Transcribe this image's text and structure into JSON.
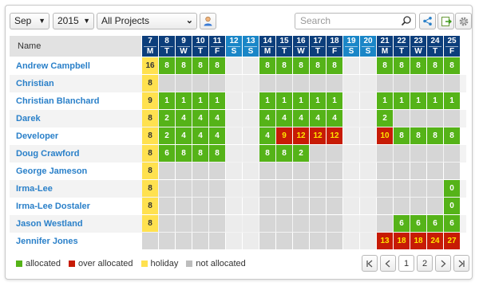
{
  "toolbar": {
    "month": "Sep",
    "year": "2015",
    "project": "All Projects",
    "search_placeholder": "Search"
  },
  "header": {
    "name_label": "Name",
    "days": [
      {
        "num": "7",
        "dow": "M",
        "weekend": false
      },
      {
        "num": "8",
        "dow": "T",
        "weekend": false
      },
      {
        "num": "9",
        "dow": "W",
        "weekend": false
      },
      {
        "num": "10",
        "dow": "T",
        "weekend": false
      },
      {
        "num": "11",
        "dow": "F",
        "weekend": false
      },
      {
        "num": "12",
        "dow": "S",
        "weekend": true
      },
      {
        "num": "13",
        "dow": "S",
        "weekend": true
      },
      {
        "num": "14",
        "dow": "M",
        "weekend": false
      },
      {
        "num": "15",
        "dow": "T",
        "weekend": false
      },
      {
        "num": "16",
        "dow": "W",
        "weekend": false
      },
      {
        "num": "17",
        "dow": "T",
        "weekend": false
      },
      {
        "num": "18",
        "dow": "F",
        "weekend": false
      },
      {
        "num": "19",
        "dow": "S",
        "weekend": true
      },
      {
        "num": "20",
        "dow": "S",
        "weekend": true
      },
      {
        "num": "21",
        "dow": "M",
        "weekend": false
      },
      {
        "num": "22",
        "dow": "T",
        "weekend": false
      },
      {
        "num": "23",
        "dow": "W",
        "weekend": false
      },
      {
        "num": "24",
        "dow": "T",
        "weekend": false
      },
      {
        "num": "25",
        "dow": "F",
        "weekend": false
      }
    ]
  },
  "colors": {
    "allocated": "#55b318",
    "over_allocated": "#c71b05",
    "holiday": "#ffe14f",
    "not_allocated": "#d6d6d6"
  },
  "rows": [
    {
      "name": "Andrew Campbell",
      "cells": [
        [
          "h",
          "16"
        ],
        [
          "a",
          "8"
        ],
        [
          "a",
          "8"
        ],
        [
          "a",
          "8"
        ],
        [
          "a",
          "8"
        ],
        [
          "w",
          ""
        ],
        [
          "w",
          ""
        ],
        [
          "a",
          "8"
        ],
        [
          "a",
          "8"
        ],
        [
          "a",
          "8"
        ],
        [
          "a",
          "8"
        ],
        [
          "a",
          "8"
        ],
        [
          "w",
          ""
        ],
        [
          "w",
          ""
        ],
        [
          "a",
          "8"
        ],
        [
          "a",
          "8"
        ],
        [
          "a",
          "8"
        ],
        [
          "a",
          "8"
        ],
        [
          "a",
          "8"
        ]
      ]
    },
    {
      "name": "Christian",
      "cells": [
        [
          "h",
          "8"
        ],
        [
          "n",
          ""
        ],
        [
          "n",
          ""
        ],
        [
          "n",
          ""
        ],
        [
          "n",
          ""
        ],
        [
          "w",
          ""
        ],
        [
          "w",
          ""
        ],
        [
          "n",
          ""
        ],
        [
          "n",
          ""
        ],
        [
          "n",
          ""
        ],
        [
          "n",
          ""
        ],
        [
          "n",
          ""
        ],
        [
          "w",
          ""
        ],
        [
          "w",
          ""
        ],
        [
          "n",
          ""
        ],
        [
          "n",
          ""
        ],
        [
          "n",
          ""
        ],
        [
          "n",
          ""
        ],
        [
          "n",
          ""
        ]
      ]
    },
    {
      "name": "Christian Blanchard",
      "cells": [
        [
          "h",
          "9"
        ],
        [
          "a",
          "1"
        ],
        [
          "a",
          "1"
        ],
        [
          "a",
          "1"
        ],
        [
          "a",
          "1"
        ],
        [
          "w",
          ""
        ],
        [
          "w",
          ""
        ],
        [
          "a",
          "1"
        ],
        [
          "a",
          "1"
        ],
        [
          "a",
          "1"
        ],
        [
          "a",
          "1"
        ],
        [
          "a",
          "1"
        ],
        [
          "w",
          ""
        ],
        [
          "w",
          ""
        ],
        [
          "a",
          "1"
        ],
        [
          "a",
          "1"
        ],
        [
          "a",
          "1"
        ],
        [
          "a",
          "1"
        ],
        [
          "a",
          "1"
        ]
      ]
    },
    {
      "name": "Darek",
      "cells": [
        [
          "h",
          "8"
        ],
        [
          "a",
          "2"
        ],
        [
          "a",
          "4"
        ],
        [
          "a",
          "4"
        ],
        [
          "a",
          "4"
        ],
        [
          "w",
          ""
        ],
        [
          "w",
          ""
        ],
        [
          "a",
          "4"
        ],
        [
          "a",
          "4"
        ],
        [
          "a",
          "4"
        ],
        [
          "a",
          "4"
        ],
        [
          "a",
          "4"
        ],
        [
          "w",
          ""
        ],
        [
          "w",
          ""
        ],
        [
          "a",
          "2"
        ],
        [
          "n",
          ""
        ],
        [
          "n",
          ""
        ],
        [
          "n",
          ""
        ],
        [
          "n",
          ""
        ]
      ]
    },
    {
      "name": "Developer",
      "cells": [
        [
          "h",
          "8"
        ],
        [
          "a",
          "2"
        ],
        [
          "a",
          "4"
        ],
        [
          "a",
          "4"
        ],
        [
          "a",
          "4"
        ],
        [
          "w",
          ""
        ],
        [
          "w",
          ""
        ],
        [
          "a",
          "4"
        ],
        [
          "o",
          "9"
        ],
        [
          "o",
          "12"
        ],
        [
          "o",
          "12"
        ],
        [
          "o",
          "12"
        ],
        [
          "w",
          ""
        ],
        [
          "w",
          ""
        ],
        [
          "o",
          "10"
        ],
        [
          "a",
          "8"
        ],
        [
          "a",
          "8"
        ],
        [
          "a",
          "8"
        ],
        [
          "a",
          "8"
        ]
      ]
    },
    {
      "name": "Doug Crawford",
      "cells": [
        [
          "h",
          "8"
        ],
        [
          "a",
          "6"
        ],
        [
          "a",
          "8"
        ],
        [
          "a",
          "8"
        ],
        [
          "a",
          "8"
        ],
        [
          "w",
          ""
        ],
        [
          "w",
          ""
        ],
        [
          "a",
          "8"
        ],
        [
          "a",
          "8"
        ],
        [
          "a",
          "2"
        ],
        [
          "n",
          ""
        ],
        [
          "n",
          ""
        ],
        [
          "w",
          ""
        ],
        [
          "w",
          ""
        ],
        [
          "n",
          ""
        ],
        [
          "n",
          ""
        ],
        [
          "n",
          ""
        ],
        [
          "n",
          ""
        ],
        [
          "n",
          ""
        ]
      ]
    },
    {
      "name": "George Jameson",
      "cells": [
        [
          "h",
          "8"
        ],
        [
          "n",
          ""
        ],
        [
          "n",
          ""
        ],
        [
          "n",
          ""
        ],
        [
          "n",
          ""
        ],
        [
          "w",
          ""
        ],
        [
          "w",
          ""
        ],
        [
          "n",
          ""
        ],
        [
          "n",
          ""
        ],
        [
          "n",
          ""
        ],
        [
          "n",
          ""
        ],
        [
          "n",
          ""
        ],
        [
          "w",
          ""
        ],
        [
          "w",
          ""
        ],
        [
          "n",
          ""
        ],
        [
          "n",
          ""
        ],
        [
          "n",
          ""
        ],
        [
          "n",
          ""
        ],
        [
          "n",
          ""
        ]
      ]
    },
    {
      "name": "Irma-Lee",
      "cells": [
        [
          "h",
          "8"
        ],
        [
          "n",
          ""
        ],
        [
          "n",
          ""
        ],
        [
          "n",
          ""
        ],
        [
          "n",
          ""
        ],
        [
          "w",
          ""
        ],
        [
          "w",
          ""
        ],
        [
          "n",
          ""
        ],
        [
          "n",
          ""
        ],
        [
          "n",
          ""
        ],
        [
          "n",
          ""
        ],
        [
          "n",
          ""
        ],
        [
          "w",
          ""
        ],
        [
          "w",
          ""
        ],
        [
          "n",
          ""
        ],
        [
          "n",
          ""
        ],
        [
          "n",
          ""
        ],
        [
          "n",
          ""
        ],
        [
          "a",
          "0"
        ]
      ]
    },
    {
      "name": "Irma-Lee Dostaler",
      "cells": [
        [
          "h",
          "8"
        ],
        [
          "n",
          ""
        ],
        [
          "n",
          ""
        ],
        [
          "n",
          ""
        ],
        [
          "n",
          ""
        ],
        [
          "w",
          ""
        ],
        [
          "w",
          ""
        ],
        [
          "n",
          ""
        ],
        [
          "n",
          ""
        ],
        [
          "n",
          ""
        ],
        [
          "n",
          ""
        ],
        [
          "n",
          ""
        ],
        [
          "w",
          ""
        ],
        [
          "w",
          ""
        ],
        [
          "n",
          ""
        ],
        [
          "n",
          ""
        ],
        [
          "n",
          ""
        ],
        [
          "n",
          ""
        ],
        [
          "a",
          "0"
        ]
      ]
    },
    {
      "name": "Jason Westland",
      "cells": [
        [
          "h",
          "8"
        ],
        [
          "n",
          ""
        ],
        [
          "n",
          ""
        ],
        [
          "n",
          ""
        ],
        [
          "n",
          ""
        ],
        [
          "w",
          ""
        ],
        [
          "w",
          ""
        ],
        [
          "n",
          ""
        ],
        [
          "n",
          ""
        ],
        [
          "n",
          ""
        ],
        [
          "n",
          ""
        ],
        [
          "n",
          ""
        ],
        [
          "w",
          ""
        ],
        [
          "w",
          ""
        ],
        [
          "n",
          ""
        ],
        [
          "a",
          "6"
        ],
        [
          "a",
          "6"
        ],
        [
          "a",
          "6"
        ],
        [
          "a",
          "6"
        ]
      ]
    },
    {
      "name": "Jennifer Jones",
      "cells": [
        [
          "n",
          ""
        ],
        [
          "n",
          ""
        ],
        [
          "n",
          ""
        ],
        [
          "n",
          ""
        ],
        [
          "n",
          ""
        ],
        [
          "w",
          ""
        ],
        [
          "w",
          ""
        ],
        [
          "n",
          ""
        ],
        [
          "n",
          ""
        ],
        [
          "n",
          ""
        ],
        [
          "n",
          ""
        ],
        [
          "n",
          ""
        ],
        [
          "w",
          ""
        ],
        [
          "w",
          ""
        ],
        [
          "o",
          "13"
        ],
        [
          "o",
          "18"
        ],
        [
          "o",
          "18"
        ],
        [
          "o",
          "24"
        ],
        [
          "o",
          "27"
        ]
      ]
    }
  ],
  "legend": [
    {
      "label": "allocated",
      "color": "#55b318"
    },
    {
      "label": "over allocated",
      "color": "#c71b05"
    },
    {
      "label": "holiday",
      "color": "#ffe14f"
    },
    {
      "label": "not allocated",
      "color": "#bdbdbd"
    }
  ],
  "pagination": {
    "first": "⏮",
    "prev": "‹",
    "pages": [
      "1",
      "2"
    ],
    "current": "1",
    "next": "›",
    "last": "⏭"
  }
}
